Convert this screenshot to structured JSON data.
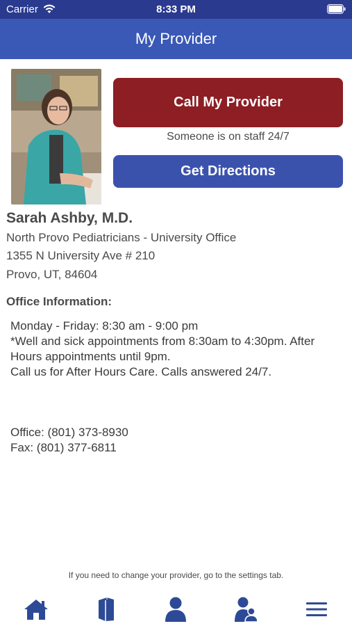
{
  "status_bar": {
    "carrier": "Carrier",
    "time": "8:33 PM",
    "wifi_icon": "wifi-icon",
    "battery_icon": "battery-icon"
  },
  "header": {
    "title": "My Provider",
    "color": "#3a58b6"
  },
  "provider": {
    "photo_icon": "provider-photo",
    "name": "Sarah Ashby, M.D.",
    "practice": "North Provo Pediatricians -  University Office",
    "street": "1355 N University Ave # 210",
    "city_state_zip": "Provo, UT, 84604"
  },
  "actions": {
    "call_label": "Call My Provider",
    "call_color": "#8c1e24",
    "staff_note": "Someone is on staff 24/7",
    "directions_label": "Get Directions",
    "directions_color": "#3b52ad"
  },
  "office_info": {
    "heading": "Office Information:",
    "hours": "Monday - Friday: 8:30 am - 9:00 pm",
    "appointments": "*Well and sick appointments from 8:30am to 4:30pm. After Hours appointments until 9pm.",
    "after_hours": "Call us for After Hours Care. Calls answered 24/7.",
    "office_phone": "Office: (801) 373-8930",
    "fax": "Fax: (801) 377-6811"
  },
  "footer": {
    "note": "If you need to change your provider, go to the settings tab."
  },
  "tab_bar": {
    "icon_color": "#2d4a96",
    "tabs": [
      {
        "icon": "home-icon"
      },
      {
        "icon": "book-icon"
      },
      {
        "icon": "person-icon"
      },
      {
        "icon": "family-icon"
      },
      {
        "icon": "menu-icon"
      }
    ]
  }
}
